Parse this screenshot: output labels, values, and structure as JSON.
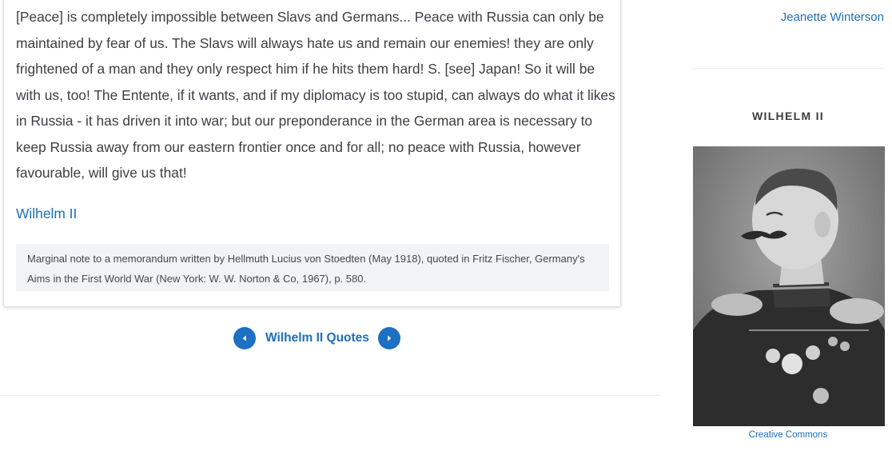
{
  "quote": {
    "text": "[Peace] is completely impossible between Slavs and Germans... Peace with Russia can only be maintained by fear of us. The Slavs will always hate us and remain our enemies! they are only frightened of a man and they only respect him if he hits them hard! S. [see] Japan! So it will be with us, too! The Entente, if it wants, and if my diplomacy is too stupid, can always do what it likes in Russia - it has driven it into war; but our preponderance in the German area is necessary to keep Russia away from our eastern frontier once and for all; no peace with Russia, however favourable, will give us that!",
    "author": "Wilhelm II",
    "source": "Marginal note to a memorandum written by Hellmuth Lucius von Stoedten (May 1918), quoted in Fritz Fischer, Germany's Aims in the First World War (New York: W. W. Norton & Co, 1967), p. 580."
  },
  "pager": {
    "label": "Wilhelm II Quotes",
    "prev_icon": "chevron-left-icon",
    "next_icon": "chevron-right-icon"
  },
  "sidebar": {
    "previous_author": "Jeanette Winterson",
    "heading": "WILHELM II",
    "photo_credit": "Creative Commons"
  },
  "colors": {
    "link": "#1d6fb8",
    "pager_button": "#1d70c2",
    "text": "#3c3f43",
    "source_bg": "#f2f3f5"
  }
}
